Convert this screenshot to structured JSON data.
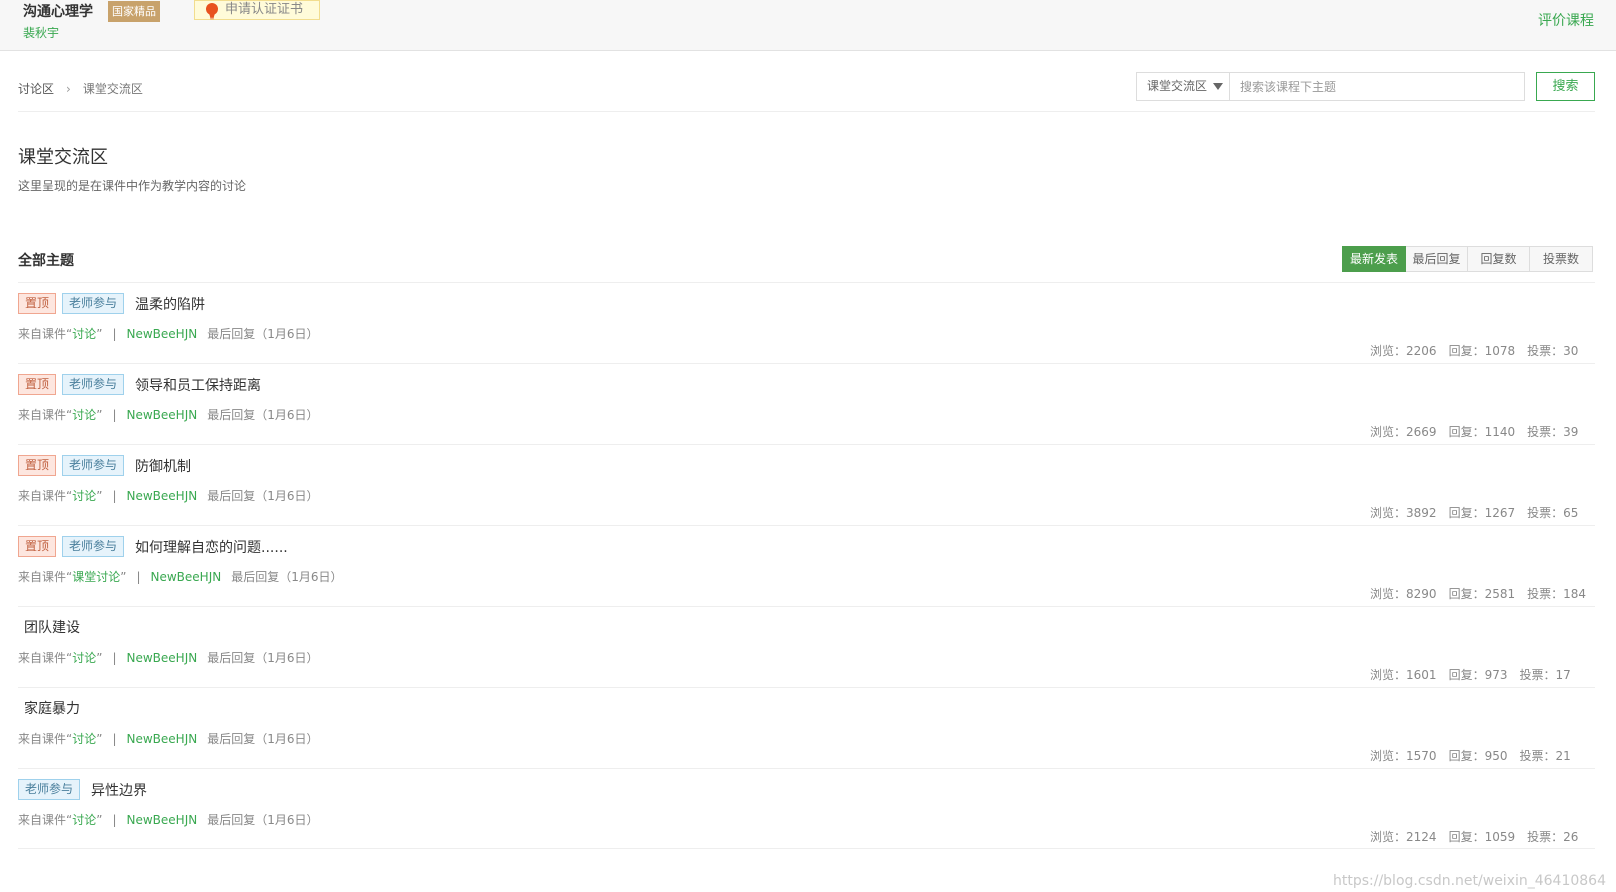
{
  "header": {
    "course_title": "沟通心理学",
    "national_badge": "国家精品",
    "teacher": "裴秋宇",
    "certificate_button": "申请认证证书",
    "rate_course": "评价课程"
  },
  "breadcrumb": {
    "root": "讨论区",
    "current": "课堂交流区"
  },
  "search": {
    "scope": "课堂交流区",
    "placeholder": "搜索该课程下主题",
    "button": "搜索"
  },
  "section": {
    "title": "课堂交流区",
    "description": "这里呈现的是在课件中作为教学内容的讨论"
  },
  "list_header": {
    "title": "全部主题",
    "sort_tabs": [
      "最新发表",
      "最后回复",
      "回复数",
      "投票数"
    ],
    "active_tab": "最新发表"
  },
  "labels": {
    "tag_pinned": "置顶",
    "tag_teacher": "老师参与",
    "from_courseware_prefix": "来自课件“",
    "from_courseware_suffix": "”",
    "last_reply": "最后回复（1月6日）",
    "views_prefix": "浏览：",
    "replies_prefix": "回复：",
    "votes_prefix": "投票："
  },
  "topics": [
    {
      "title": "温柔的陷阱",
      "pinned": true,
      "teacher": true,
      "source": "讨论",
      "author": "NewBeeHJN",
      "views": "2206",
      "replies": "1078",
      "votes": "30"
    },
    {
      "title": "领导和员工保持距离",
      "pinned": true,
      "teacher": true,
      "source": "讨论",
      "author": "NewBeeHJN",
      "views": "2669",
      "replies": "1140",
      "votes": "39"
    },
    {
      "title": "防御机制",
      "pinned": true,
      "teacher": true,
      "source": "讨论",
      "author": "NewBeeHJN",
      "views": "3892",
      "replies": "1267",
      "votes": "65"
    },
    {
      "title": "如何理解自恋的问题......",
      "pinned": true,
      "teacher": true,
      "source": "课堂讨论",
      "author": "NewBeeHJN",
      "views": "8290",
      "replies": "2581",
      "votes": "184"
    },
    {
      "title": "团队建设",
      "pinned": false,
      "teacher": false,
      "source": "讨论",
      "author": "NewBeeHJN",
      "views": "1601",
      "replies": "973",
      "votes": "17"
    },
    {
      "title": "家庭暴力",
      "pinned": false,
      "teacher": false,
      "source": "讨论",
      "author": "NewBeeHJN",
      "views": "1570",
      "replies": "950",
      "votes": "21"
    },
    {
      "title": "异性边界",
      "pinned": false,
      "teacher": true,
      "source": "讨论",
      "author": "NewBeeHJN",
      "views": "2124",
      "replies": "1059",
      "votes": "26"
    }
  ],
  "watermark": "https://blog.csdn.net/weixin_46410864",
  "colors": {
    "brand_green": "#39a850",
    "active_tab": "#4c9e4c",
    "badge_gold": "#c8a26b"
  }
}
